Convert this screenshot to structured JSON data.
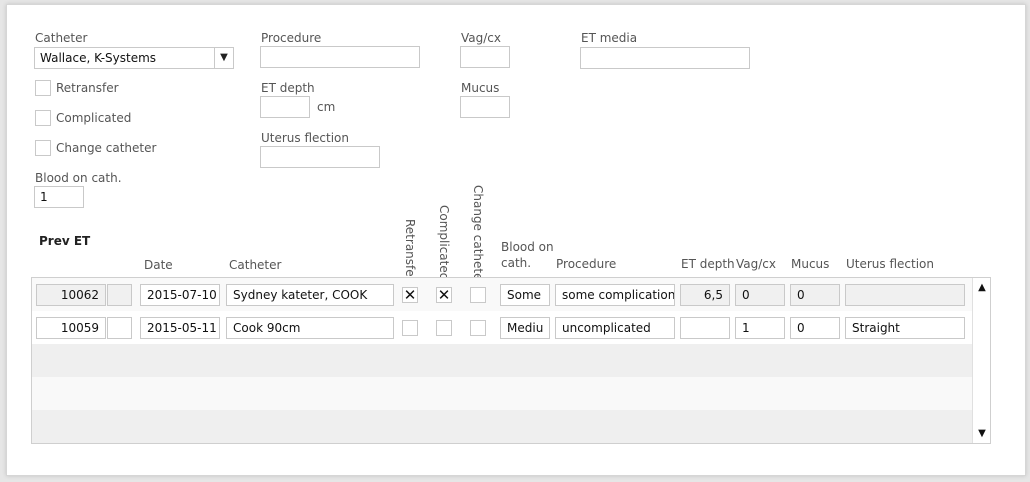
{
  "form": {
    "catheter_label": "Catheter",
    "catheter_value": "Wallace, K-Systems",
    "retransfer_label": "Retransfer",
    "complicated_label": "Complicated",
    "change_catheter_label": "Change catheter",
    "blood_label": "Blood on cath.",
    "blood_value": "1",
    "procedure_label": "Procedure",
    "procedure_value": "",
    "et_depth_label": "ET depth",
    "et_depth_value": "",
    "et_depth_unit": "cm",
    "uterus_label": "Uterus flection",
    "uterus_value": "",
    "vagcx_label": "Vag/cx",
    "vagcx_value": "",
    "mucus_label": "Mucus",
    "mucus_value": "",
    "et_media_label": "ET media",
    "et_media_value": ""
  },
  "table": {
    "title": "Prev ET",
    "headers": {
      "date": "Date",
      "catheter": "Catheter",
      "retransfer": "Retransfer",
      "complicated": "Complicated",
      "change_catheter": "Change catheter",
      "blood_line1": "Blood on",
      "blood_line2": "cath.",
      "procedure": "Procedure",
      "et_depth": "ET depth",
      "vagcx": "Vag/cx",
      "mucus": "Mucus",
      "uterus": "Uterus flection"
    },
    "rows": [
      {
        "id": "10062",
        "date": "2015-07-10",
        "catheter": "Sydney kateter, COOK",
        "retransfer": "✕",
        "complicated": "✕",
        "change_catheter": "",
        "blood": "Some",
        "procedure": "some complication",
        "et_depth": "6,5",
        "vagcx": "0",
        "mucus": "0",
        "uterus": ""
      },
      {
        "id": "10059",
        "date": "2015-05-11",
        "catheter": "Cook 90cm",
        "retransfer": "",
        "complicated": "",
        "change_catheter": "",
        "blood": "Mediu",
        "procedure": "uncomplicated",
        "et_depth": "",
        "vagcx": "1",
        "mucus": "0",
        "uterus": "Straight"
      }
    ]
  },
  "scrollbar": {
    "up": "▲",
    "down": "▼"
  },
  "dropdown_arrow": "▼",
  "colors": {
    "band_light": "#f9f9f9",
    "band_dark": "#efefef",
    "border": "#c9c9c9"
  }
}
